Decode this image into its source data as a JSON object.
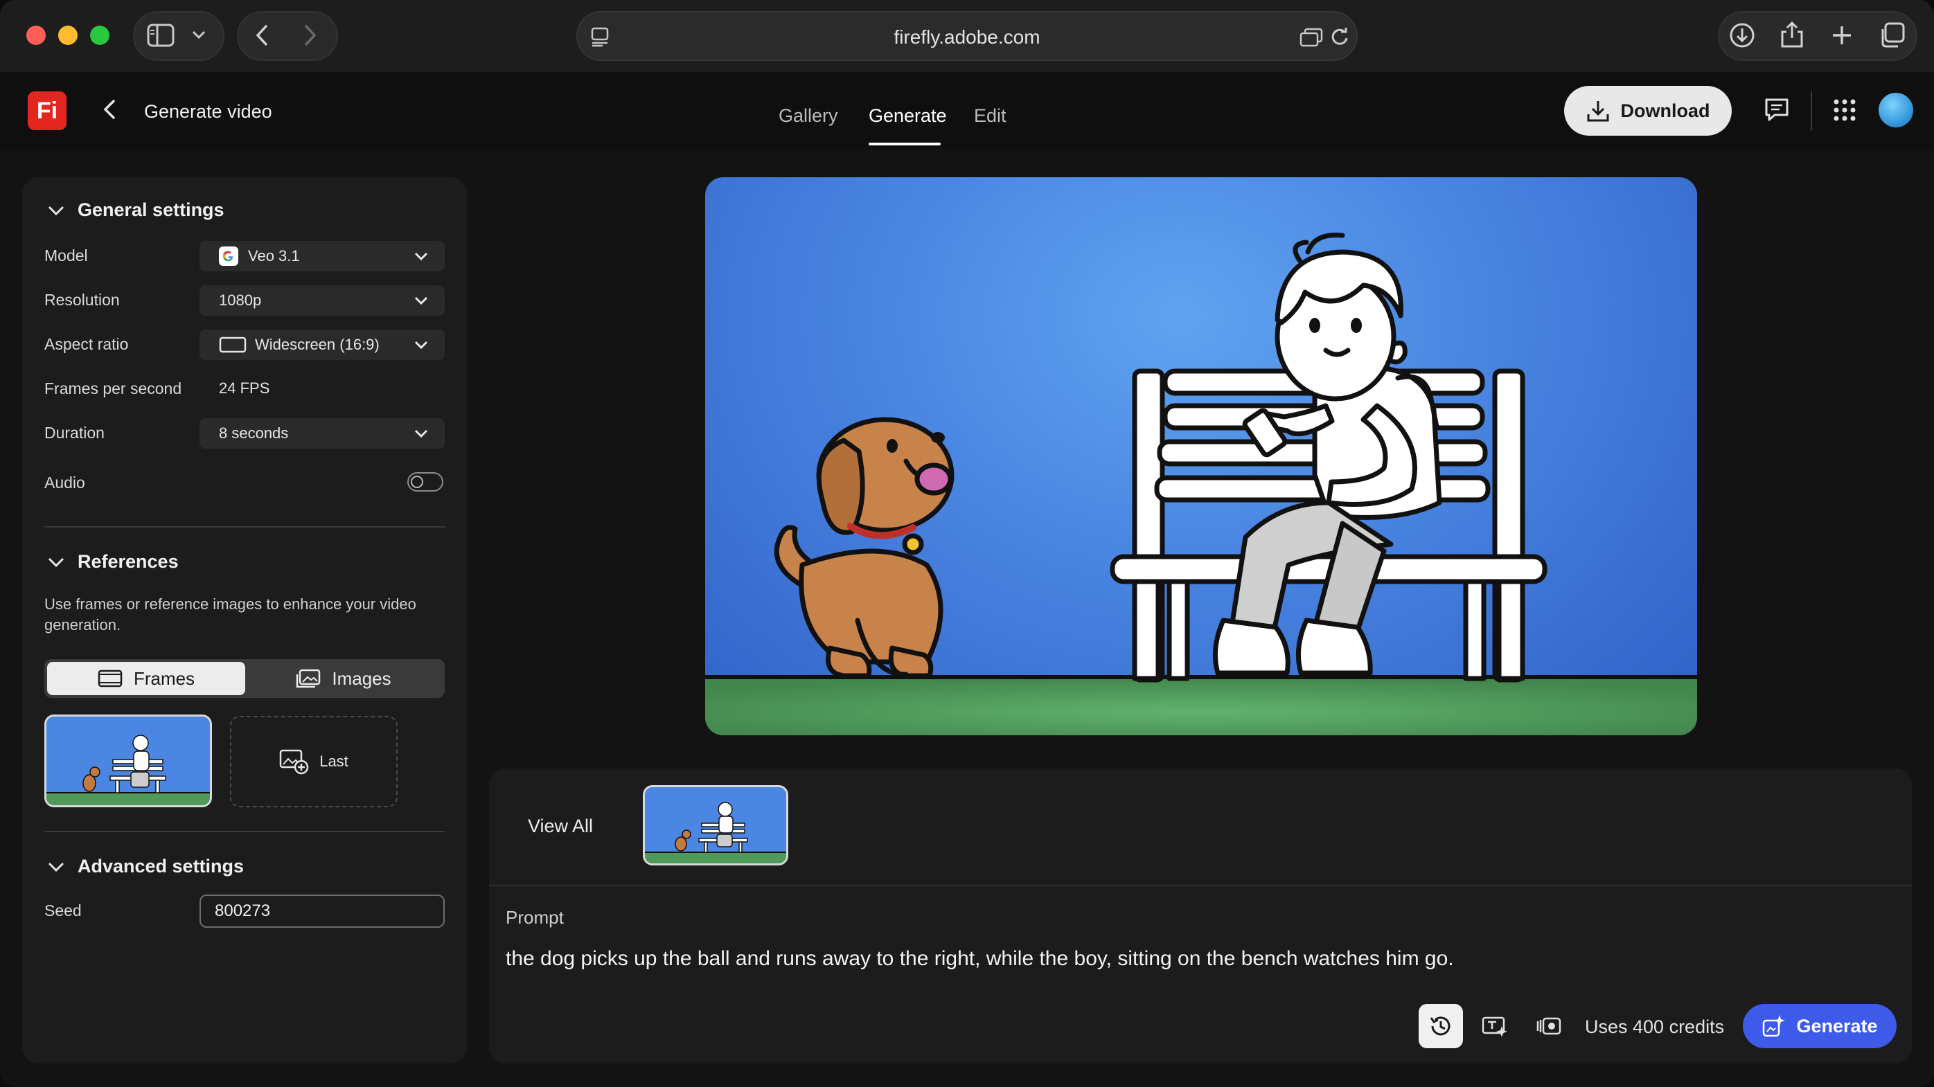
{
  "browser": {
    "url": "firefly.adobe.com",
    "icons": [
      "sidebar-icon",
      "chevron-down-icon",
      "back-icon",
      "forward-icon",
      "page-menu-icon",
      "reader-icon",
      "reload-icon",
      "downloads-icon",
      "share-icon",
      "new-tab-icon",
      "tabs-overview-icon"
    ]
  },
  "app": {
    "logo": "Fi",
    "title": "Generate video",
    "nav": [
      "Gallery",
      "Generate",
      "Edit"
    ],
    "active_tab": "Generate",
    "download_label": "Download"
  },
  "general_settings": {
    "header": "General settings",
    "model_label": "Model",
    "model_value": "Veo 3.1",
    "resolution_label": "Resolution",
    "resolution_value": "1080p",
    "aspect_label": "Aspect ratio",
    "aspect_value": "Widescreen (16:9)",
    "fps_label": "Frames per second",
    "fps_value": "24 FPS",
    "duration_label": "Duration",
    "duration_value": "8 seconds",
    "audio_label": "Audio",
    "audio_on": false
  },
  "references": {
    "header": "References",
    "description": "Use frames or reference images to enhance your video generation.",
    "frames_label": "Frames",
    "images_label": "Images",
    "last_label": "Last"
  },
  "advanced_settings": {
    "header": "Advanced settings",
    "seed_label": "Seed",
    "seed_value": "800273"
  },
  "gallery_strip": {
    "view_all": "View All"
  },
  "prompt": {
    "label": "Prompt",
    "text": "the dog picks up the ball and runs away to the right, while the boy, sitting on the bench watches him go.",
    "credits": "Uses 400 credits",
    "generate_label": "Generate"
  },
  "colors": {
    "accent": "#3d5be8",
    "logo": "#e3261f",
    "sky": "#4a86e2",
    "grass": "#4f9a5a"
  }
}
